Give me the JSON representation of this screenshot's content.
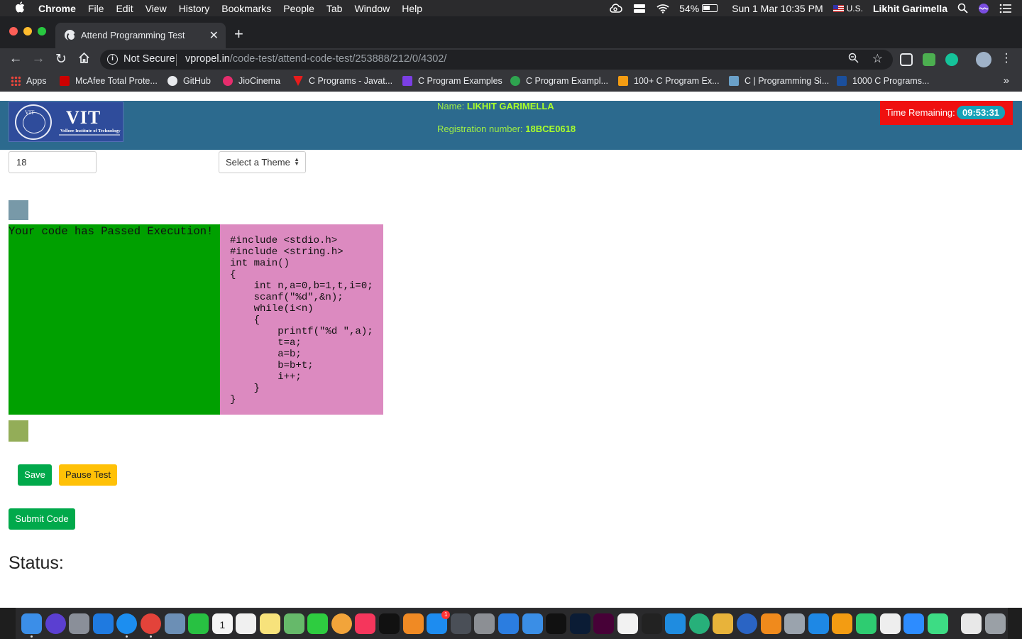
{
  "menubar": {
    "items": [
      "Chrome",
      "File",
      "Edit",
      "View",
      "History",
      "Bookmarks",
      "People",
      "Tab",
      "Window",
      "Help"
    ],
    "battery": "54%",
    "datetime": "Sun 1 Mar  10:35 PM",
    "input_source": "U.S.",
    "user": "Likhit Garimella"
  },
  "tab": {
    "title": "Attend Programming Test"
  },
  "omnibox": {
    "security": "Not Secure",
    "domain": "vpropel.in",
    "path": "/code-test/attend-code-test/253888/212/0/4302/"
  },
  "bookmarks": [
    {
      "label": "Apps",
      "color": "#e8453c"
    },
    {
      "label": "McAfee Total Prote...",
      "color": "#c00"
    },
    {
      "label": "GitHub",
      "color": "#e8eaed"
    },
    {
      "label": "JioCinema",
      "color": "#e62d6d"
    },
    {
      "label": "C Programs - Javat...",
      "color": "#e81c1c"
    },
    {
      "label": "C Program Examples",
      "color": "#7b3fe4"
    },
    {
      "label": "C Program Exampl...",
      "color": "#2ea44f"
    },
    {
      "label": "100+ C Program Ex...",
      "color": "#f39c12"
    },
    {
      "label": "C | Programming Si...",
      "color": "#6aa0c8"
    },
    {
      "label": "1000 C Programs...",
      "color": "#1b4f9c"
    }
  ],
  "header": {
    "logo_text": "VIT",
    "logo_seal": "VIT",
    "logo_sub": "Vellore Institute of Technology",
    "name_label": "Name:",
    "name_value": "LIKHIT GARIMELLA",
    "reg_label": "Registration number:",
    "reg_value": "18BCE0618",
    "timer_label": "Time Remaining:",
    "timer_value": "09:53:31"
  },
  "editor": {
    "font_size": "18",
    "theme_placeholder": "Select a Theme",
    "output": "Your code has Passed Execution!",
    "code": "#include <stdio.h>\n#include <string.h>\nint main()\n{\n    int n,a=0,b=1,t,i=0;\n    scanf(\"%d\",&n);\n    while(i<n)\n    {\n        printf(\"%d \",a);\n        t=a;\n        a=b;\n        b=b+t;\n        i++;\n    }\n}"
  },
  "buttons": {
    "save": "Save",
    "pause": "Pause Test",
    "submit": "Submit Code"
  },
  "status_label": "Status:",
  "dock": {
    "calendar_day": "1",
    "appstore_badge": "1",
    "apps": [
      {
        "name": "finder-icon",
        "color": "#3b8ee8"
      },
      {
        "name": "siri-icon",
        "color": "#5b3fd1"
      },
      {
        "name": "launchpad-icon",
        "color": "#8a8f99"
      },
      {
        "name": "bluetooth-icon",
        "color": "#1f7ae0"
      },
      {
        "name": "safari-icon",
        "color": "#1c8ef0"
      },
      {
        "name": "chrome-icon",
        "color": "#e3433a"
      },
      {
        "name": "preview-icon",
        "color": "#6c8fb5"
      },
      {
        "name": "whatsapp-icon",
        "color": "#28c142"
      },
      {
        "name": "calendar-icon",
        "color": "#f5f5f5"
      },
      {
        "name": "reminders-icon",
        "color": "#f0f0f0"
      },
      {
        "name": "notes-icon",
        "color": "#f7e27b"
      },
      {
        "name": "maps-icon",
        "color": "#66b96a"
      },
      {
        "name": "facetime-icon",
        "color": "#2ecc40"
      },
      {
        "name": "photos-icon",
        "color": "#f2a43a"
      },
      {
        "name": "music-icon",
        "color": "#f5365c"
      },
      {
        "name": "tv-icon",
        "color": "#111111"
      },
      {
        "name": "books-icon",
        "color": "#f08a24"
      },
      {
        "name": "appstore-icon",
        "color": "#1d8cf0"
      },
      {
        "name": "xcode-instruments-icon",
        "color": "#4a4f57"
      },
      {
        "name": "system-preferences-icon",
        "color": "#8c8f94"
      },
      {
        "name": "xcode-icon",
        "color": "#2b7de0"
      },
      {
        "name": "xcode-2-icon",
        "color": "#3a8ee6"
      },
      {
        "name": "terminal-icon",
        "color": "#111111"
      },
      {
        "name": "photoshop-icon",
        "color": "#0b1c35"
      },
      {
        "name": "adobe-xd-icon",
        "color": "#470137"
      },
      {
        "name": "unity-icon",
        "color": "#f2f2f2"
      },
      {
        "name": "unity-hub-icon",
        "color": "#222222"
      },
      {
        "name": "vscode-icon",
        "color": "#1f8ce0"
      },
      {
        "name": "atom-icon",
        "color": "#27b07a"
      },
      {
        "name": "ticket-viewer-icon",
        "color": "#e8b33a"
      },
      {
        "name": "quicktime-icon",
        "color": "#2a64c4"
      },
      {
        "name": "vlc-icon",
        "color": "#f08a1c"
      },
      {
        "name": "disk-utility-icon",
        "color": "#9aa3ad"
      },
      {
        "name": "keynote-icon",
        "color": "#1e88e5"
      },
      {
        "name": "pages-icon",
        "color": "#f39c12"
      },
      {
        "name": "numbers-icon",
        "color": "#2ecc71"
      },
      {
        "name": "textedit-icon",
        "color": "#eeeeee"
      },
      {
        "name": "zoom-icon",
        "color": "#2d8cff"
      },
      {
        "name": "android-studio-icon",
        "color": "#3ddc84"
      },
      {
        "name": "downloads-icon",
        "color": "#e8e8e8"
      },
      {
        "name": "trash-icon",
        "color": "#9aa0a6"
      }
    ]
  },
  "colors": {
    "header": "#2c6a8e",
    "output_bg": "#00a000",
    "code_bg": "#dc8ac0",
    "timer_bg": "#ef1010",
    "save": "#01a94b",
    "pause": "#ffc107"
  }
}
